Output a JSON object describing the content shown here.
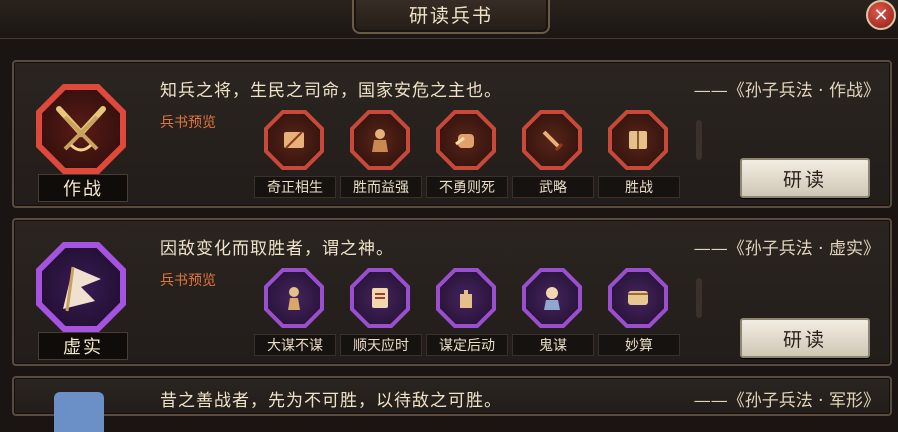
{
  "window": {
    "title": "研读兵书",
    "close_symbol": "✕"
  },
  "cards": [
    {
      "emblem_label": "作战",
      "quote": "知兵之将，生民之司命，国家安危之主也。",
      "source": "——《孙子兵法 · 作战》",
      "preview_label": "兵书预览",
      "skills": [
        "奇正相生",
        "胜而益强",
        "不勇则死",
        "武略",
        "胜战"
      ],
      "button": "研读",
      "color": "#e0483b"
    },
    {
      "emblem_label": "虚实",
      "quote": "因敌变化而取胜者，谓之神。",
      "source": "——《孙子兵法 · 虚实》",
      "preview_label": "兵书预览",
      "skills": [
        "大谋不谋",
        "顺天应时",
        "谋定后动",
        "鬼谋",
        "妙算"
      ],
      "button": "研读",
      "color": "#a553e0"
    },
    {
      "quote": "昔之善战者，先为不可胜，以待敌之可胜。",
      "source": "——《孙子兵法 · 军形》"
    }
  ]
}
